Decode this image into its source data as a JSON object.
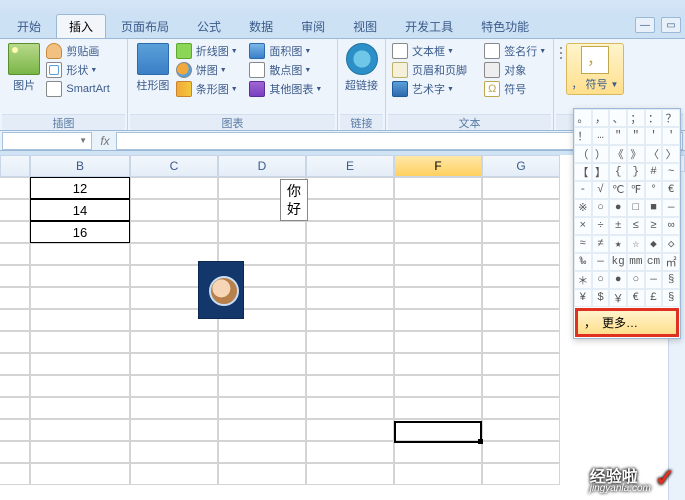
{
  "tabs": {
    "start": "开始",
    "insert": "插入",
    "layout": "页面布局",
    "formula": "公式",
    "data": "数据",
    "review": "审阅",
    "view": "视图",
    "dev": "开发工具",
    "special": "特色功能"
  },
  "ribbon": {
    "groups": {
      "illustrations": "插图",
      "charts": "图表",
      "links": "链接",
      "text": "文本"
    },
    "picture": "图片",
    "clipart": "剪贴画",
    "shapes": "形状",
    "smartart": "SmartArt",
    "column_chart": "柱形图",
    "line_chart": "折线图",
    "pie_chart": "饼图",
    "bar_chart": "条形图",
    "area_chart": "面积图",
    "scatter_chart": "散点图",
    "other_chart": "其他图表",
    "hyperlink": "超链接",
    "textbox": "文本框",
    "header_footer": "页眉和页脚",
    "wordart": "艺术字",
    "signature": "签名行",
    "object": "对象",
    "symbol": "符号"
  },
  "symbol_panel": {
    "grid": [
      "。",
      "，",
      "、",
      "；",
      "：",
      "？",
      "！",
      "…",
      "\"",
      "\"",
      "'",
      "'",
      "（",
      "）",
      "《",
      "》",
      "〈",
      "〉",
      "【",
      "】",
      "{",
      "}",
      "#",
      "~",
      "-",
      "√",
      "℃",
      "℉",
      "°",
      "€",
      "※",
      "○",
      "●",
      "□",
      "■",
      "—",
      "×",
      "÷",
      "±",
      "≤",
      "≥",
      "∞",
      "≈",
      "≠",
      "★",
      "☆",
      "◆",
      "◇",
      "‰",
      "—",
      "kg",
      "mm",
      "cm",
      "㎡",
      "＊",
      "○",
      "●",
      "○",
      "—",
      "§",
      "¥",
      "$",
      "￥",
      "€",
      "£",
      "§"
    ],
    "more_symbol": "，",
    "more_label": "更多…"
  },
  "formula_bar": {
    "name_box": "",
    "fx": "fx",
    "value": ""
  },
  "sheet": {
    "cols": [
      "",
      "B",
      "C",
      "D",
      "E",
      "F",
      "G"
    ],
    "data_b": [
      "12",
      "14",
      "16"
    ],
    "textbox": "你\n好"
  },
  "watermark": {
    "main": "经验啦",
    "sub": "jingyanla.com"
  }
}
